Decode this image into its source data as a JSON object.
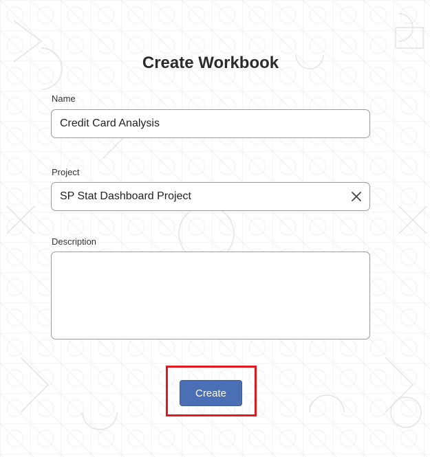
{
  "dialog": {
    "title": "Create Workbook"
  },
  "fields": {
    "name": {
      "label": "Name",
      "value": "Credit Card Analysis"
    },
    "project": {
      "label": "Project",
      "value": "SP Stat Dashboard Project",
      "clear_icon": "close-icon"
    },
    "description": {
      "label": "Description",
      "value": ""
    }
  },
  "actions": {
    "create_label": "Create"
  },
  "colors": {
    "primary_button": "#4a6fb5",
    "highlight": "#e0191f",
    "pattern_stroke": "#e6e6e6"
  }
}
